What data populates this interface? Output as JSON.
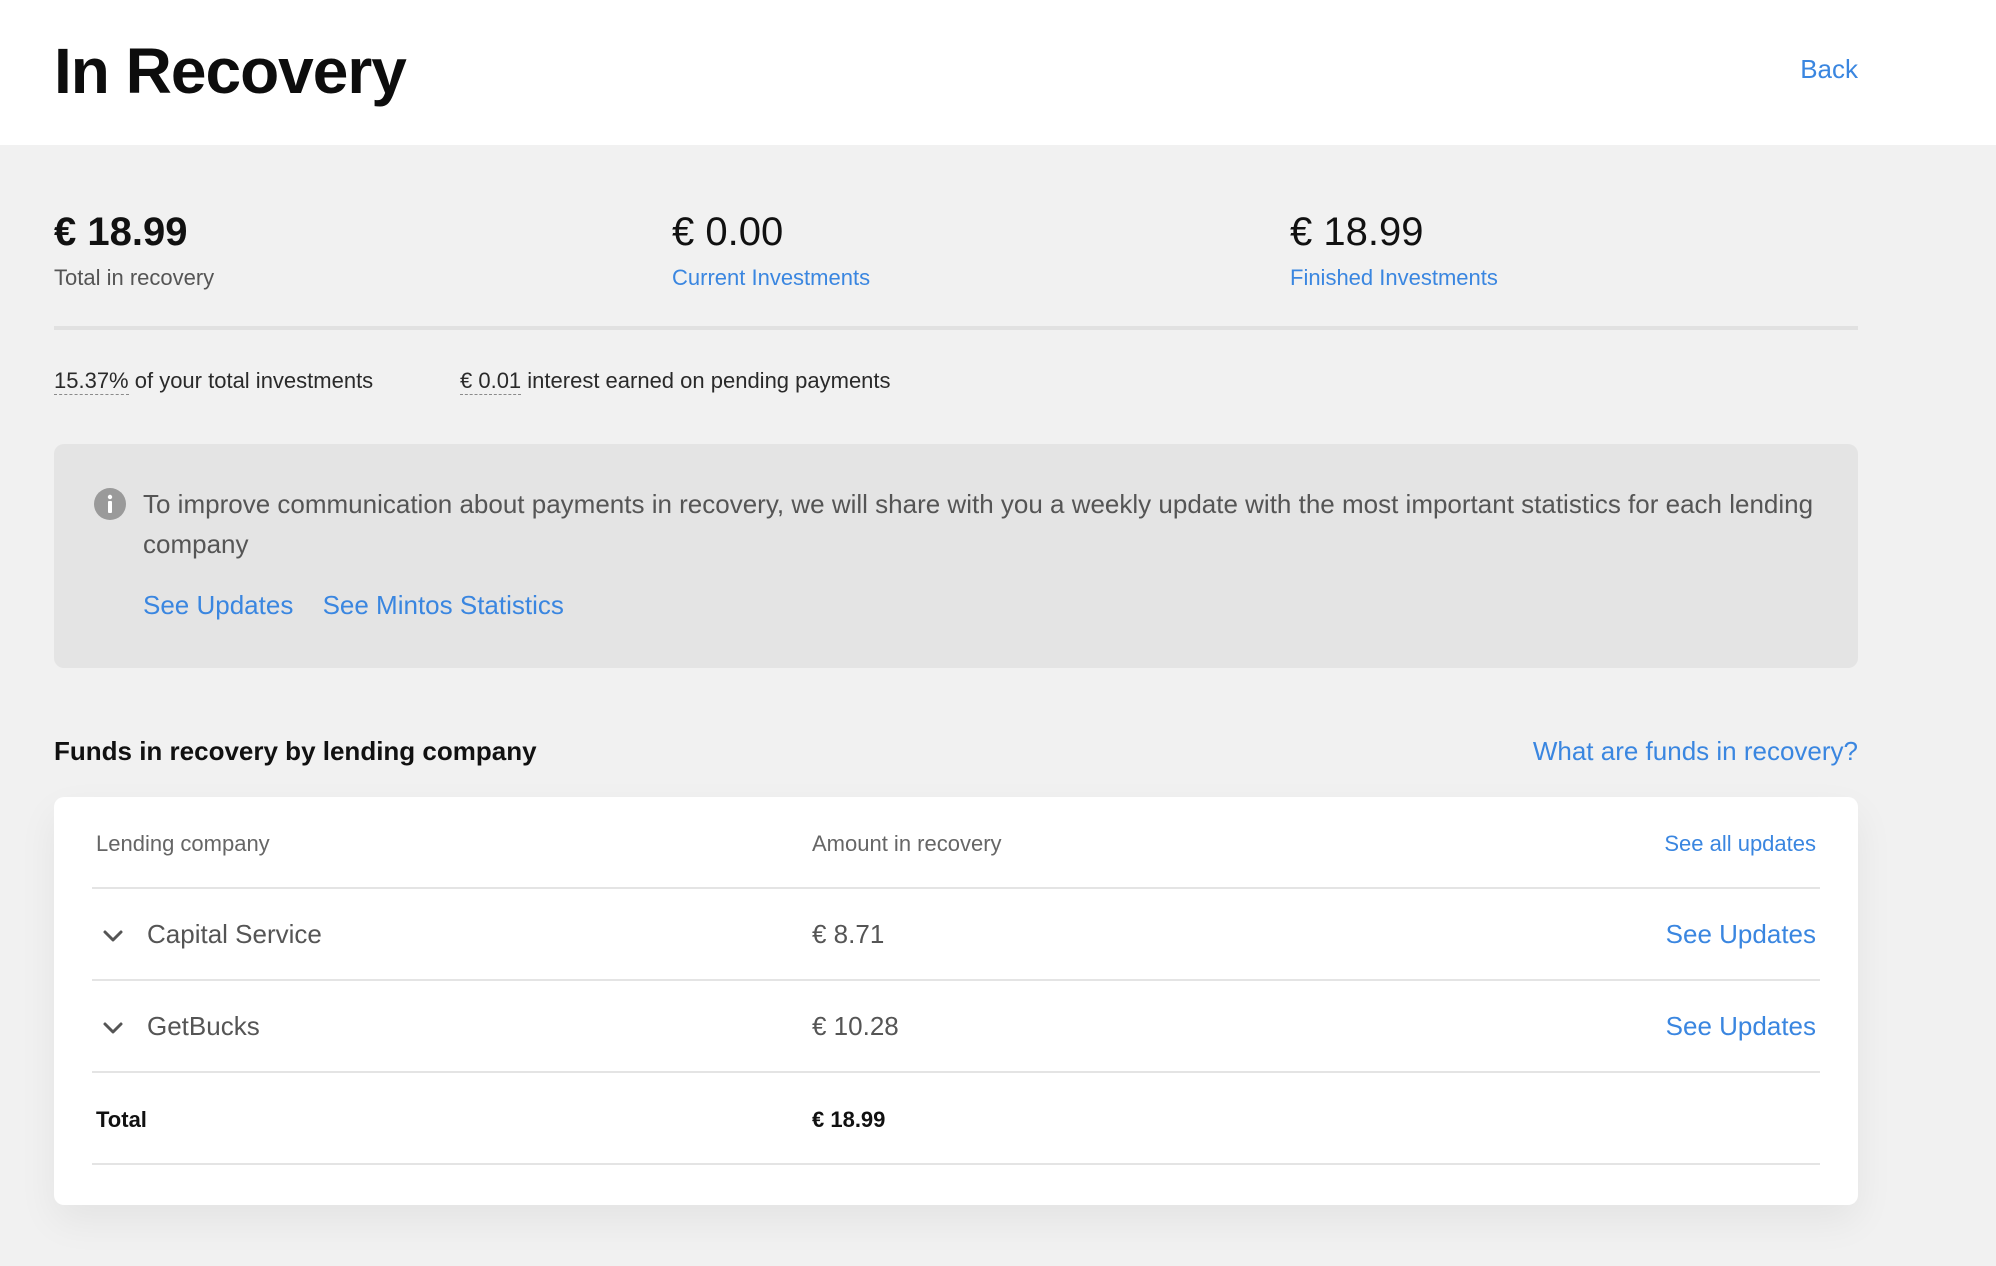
{
  "header": {
    "title": "In Recovery",
    "back_label": "Back"
  },
  "summary": {
    "total": {
      "amount": "€ 18.99",
      "label": "Total in recovery"
    },
    "current": {
      "amount": "€ 0.00",
      "label": "Current Investments"
    },
    "finished": {
      "amount": "€ 18.99",
      "label": "Finished Investments"
    }
  },
  "meta": {
    "percent_value": "15.37%",
    "percent_text": " of your total investments",
    "interest_value": "€ 0.01",
    "interest_text": " interest earned on pending payments"
  },
  "notice": {
    "icon": "info-icon",
    "text": "To improve communication about payments in recovery, we will share with you a weekly update with the most important statistics for each lending company",
    "link_updates": "See Updates",
    "link_statistics": "See Mintos Statistics"
  },
  "section": {
    "title": "Funds in recovery by lending company",
    "help_link": "What are funds in recovery?"
  },
  "table": {
    "headers": {
      "company": "Lending company",
      "amount": "Amount in recovery",
      "action": "See all updates"
    },
    "rows": [
      {
        "company": "Capital Service",
        "amount": "€ 8.71",
        "action": "See Updates"
      },
      {
        "company": "GetBucks",
        "amount": "€ 10.28",
        "action": "See Updates"
      }
    ],
    "total": {
      "label": "Total",
      "amount": "€ 18.99"
    }
  },
  "colors": {
    "accent": "#3a86e0",
    "background": "#f1f1f1",
    "notice_bg": "#e4e4e4"
  }
}
